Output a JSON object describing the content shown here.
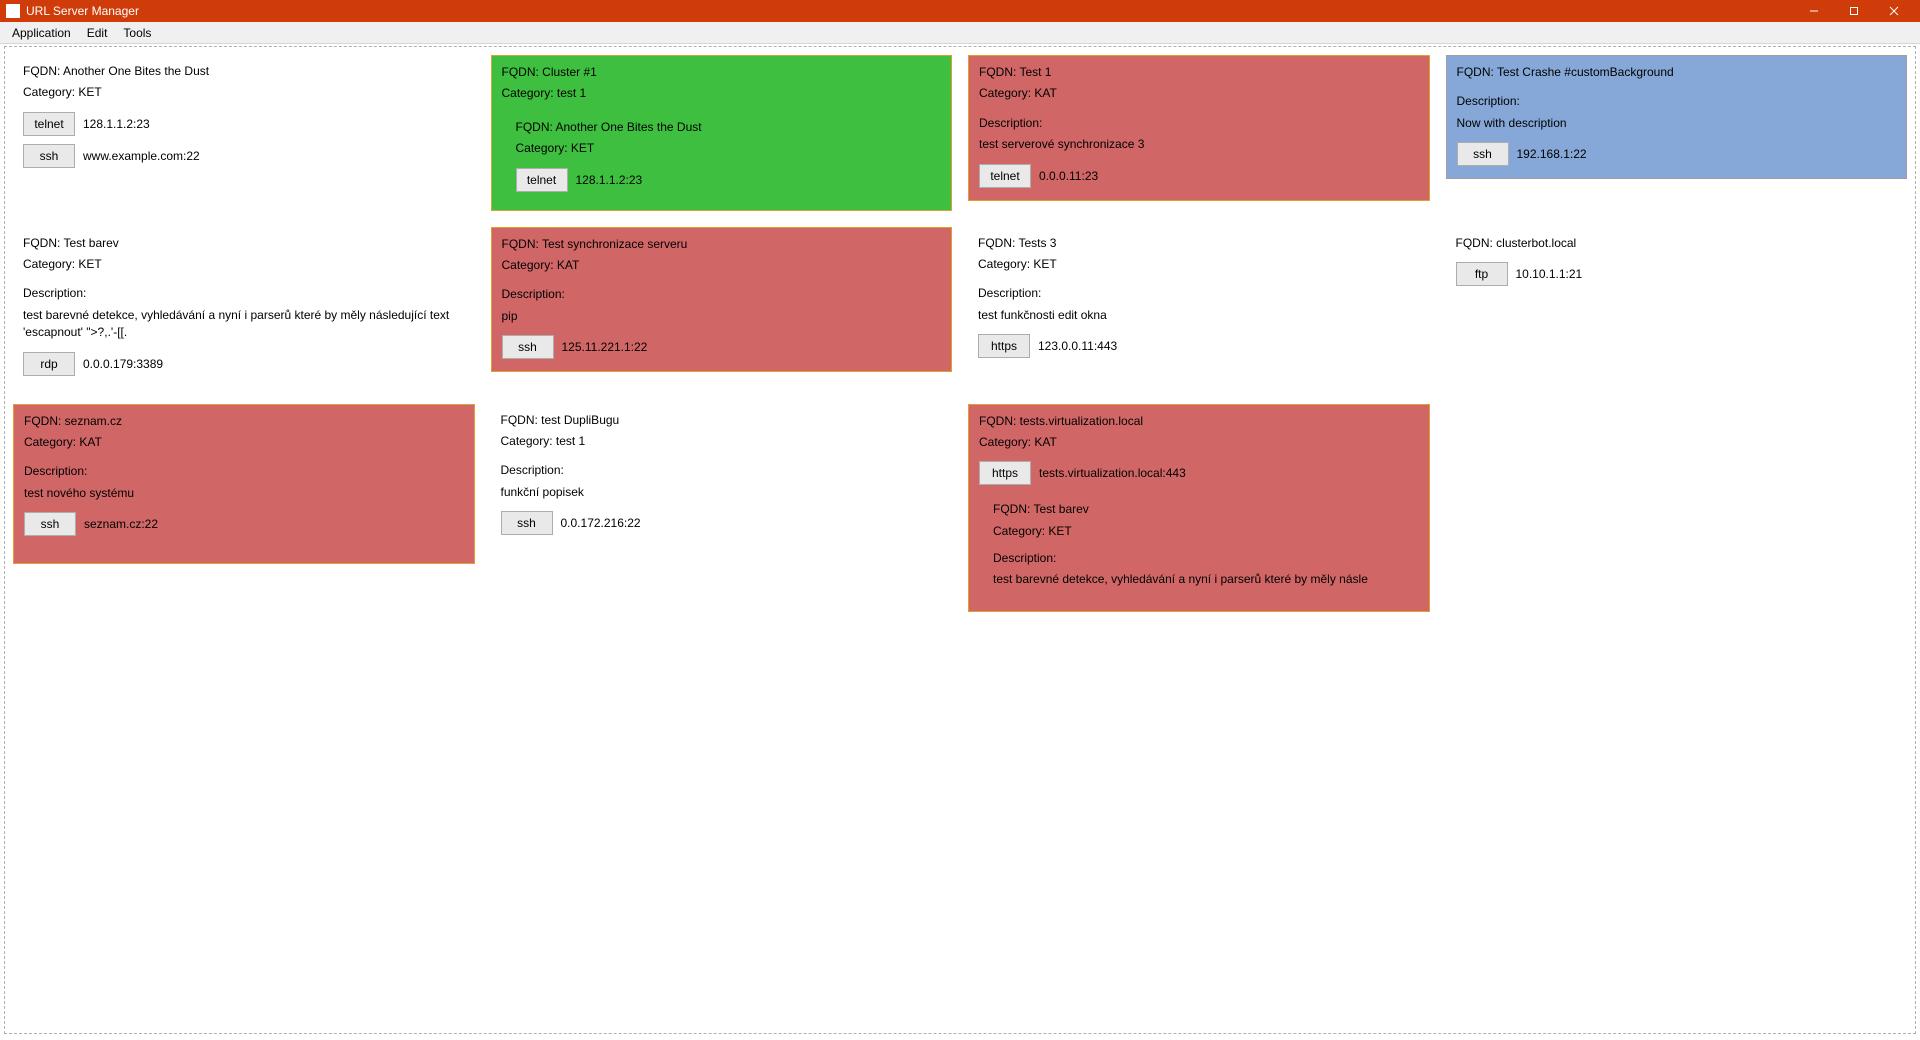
{
  "window": {
    "title": "URL Server Manager"
  },
  "menu": {
    "items": [
      "Application",
      "Edit",
      "Tools"
    ]
  },
  "labels": {
    "fqdn_prefix": "FQDN: ",
    "category_prefix": "Category: ",
    "description_label": "Description:"
  },
  "cards": [
    {
      "fqdn": "Another One Bites the Dust",
      "category": "KET",
      "style": "plain",
      "actions": [
        {
          "proto": "telnet",
          "addr": "128.1.1.2:23"
        },
        {
          "proto": "ssh",
          "addr": "www.example.com:22"
        }
      ]
    },
    {
      "fqdn": "Cluster #1",
      "category": "test 1",
      "style": "green",
      "nested": {
        "fqdn": "Another One Bites the Dust",
        "category": "KET",
        "actions": [
          {
            "proto": "telnet",
            "addr": "128.1.1.2:23"
          }
        ]
      }
    },
    {
      "fqdn": "Test 1",
      "category": "KAT",
      "style": "red",
      "description": "test serverové synchronizace 3",
      "actions": [
        {
          "proto": "telnet",
          "addr": "0.0.0.11:23"
        }
      ]
    },
    {
      "fqdn": "Test Crashe #customBackground",
      "style": "blue",
      "description": "Now with description",
      "actions": [
        {
          "proto": "ssh",
          "addr": "192.168.1:22"
        }
      ]
    },
    {
      "fqdn": "Test barev",
      "category": "KET",
      "style": "plain",
      "description": "test barevné detekce, vyhledávání a nyní i parserů které by měly následující text 'escapnout' \">?,.'-[[.",
      "actions": [
        {
          "proto": "rdp",
          "addr": "0.0.0.179:3389"
        }
      ]
    },
    {
      "fqdn": "Test synchronizace serveru",
      "category": "KAT",
      "style": "red",
      "description": "pip",
      "actions": [
        {
          "proto": "ssh",
          "addr": "125.11.221.1:22"
        }
      ]
    },
    {
      "fqdn": "Tests 3",
      "category": "KET",
      "style": "plain",
      "description": "test funkčnosti edit okna",
      "actions": [
        {
          "proto": "https",
          "addr": "123.0.0.11:443"
        }
      ]
    },
    {
      "fqdn": "clusterbot.local",
      "style": "plain",
      "actions": [
        {
          "proto": "ftp",
          "addr": "10.10.1.1:21"
        }
      ]
    },
    {
      "fqdn": "seznam.cz",
      "category": "KAT",
      "style": "red",
      "tall": true,
      "description": "test nového systému",
      "actions": [
        {
          "proto": "ssh",
          "addr": "seznam.cz:22"
        }
      ]
    },
    {
      "fqdn": "test DupliBugu",
      "category": "test 1",
      "style": "plain",
      "description": "funkční popisek",
      "actions": [
        {
          "proto": "ssh",
          "addr": "0.0.172.216:22"
        }
      ]
    },
    {
      "fqdn": "tests.virtualization.local",
      "category": "KAT",
      "style": "red",
      "actions": [
        {
          "proto": "https",
          "addr": "tests.virtualization.local:443"
        }
      ],
      "nested": {
        "fqdn": "Test barev",
        "category": "KET",
        "description": "test barevné detekce, vyhledávání a nyní i parserů které by měly násle"
      }
    }
  ]
}
